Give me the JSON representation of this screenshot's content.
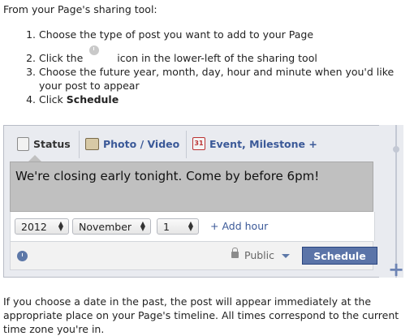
{
  "intro": "From your Page's sharing tool:",
  "steps": {
    "s1": "Choose the type of post you want to add to your Page",
    "s2_before": "Click the",
    "s2_after": "icon in the lower-left of the sharing tool",
    "s3": "Choose the future year, month, day, hour and minute when you'd like your post to appear",
    "s4_before": "Click",
    "s4_bold": "Schedule"
  },
  "composer": {
    "tabs": [
      "Status",
      "Photo / Video",
      "Event, Milestone +"
    ],
    "status_text": "We're closing early tonight. Come by before 6pm!",
    "year": "2012",
    "month": "November",
    "day": "1",
    "add_hour": "+ Add hour",
    "privacy": "Public",
    "schedule_label": "Schedule"
  },
  "outro": "If you choose a date in the past, the post will appear immediately at the appropriate place on your Page's timeline. All times correspond to the current time zone you're in."
}
